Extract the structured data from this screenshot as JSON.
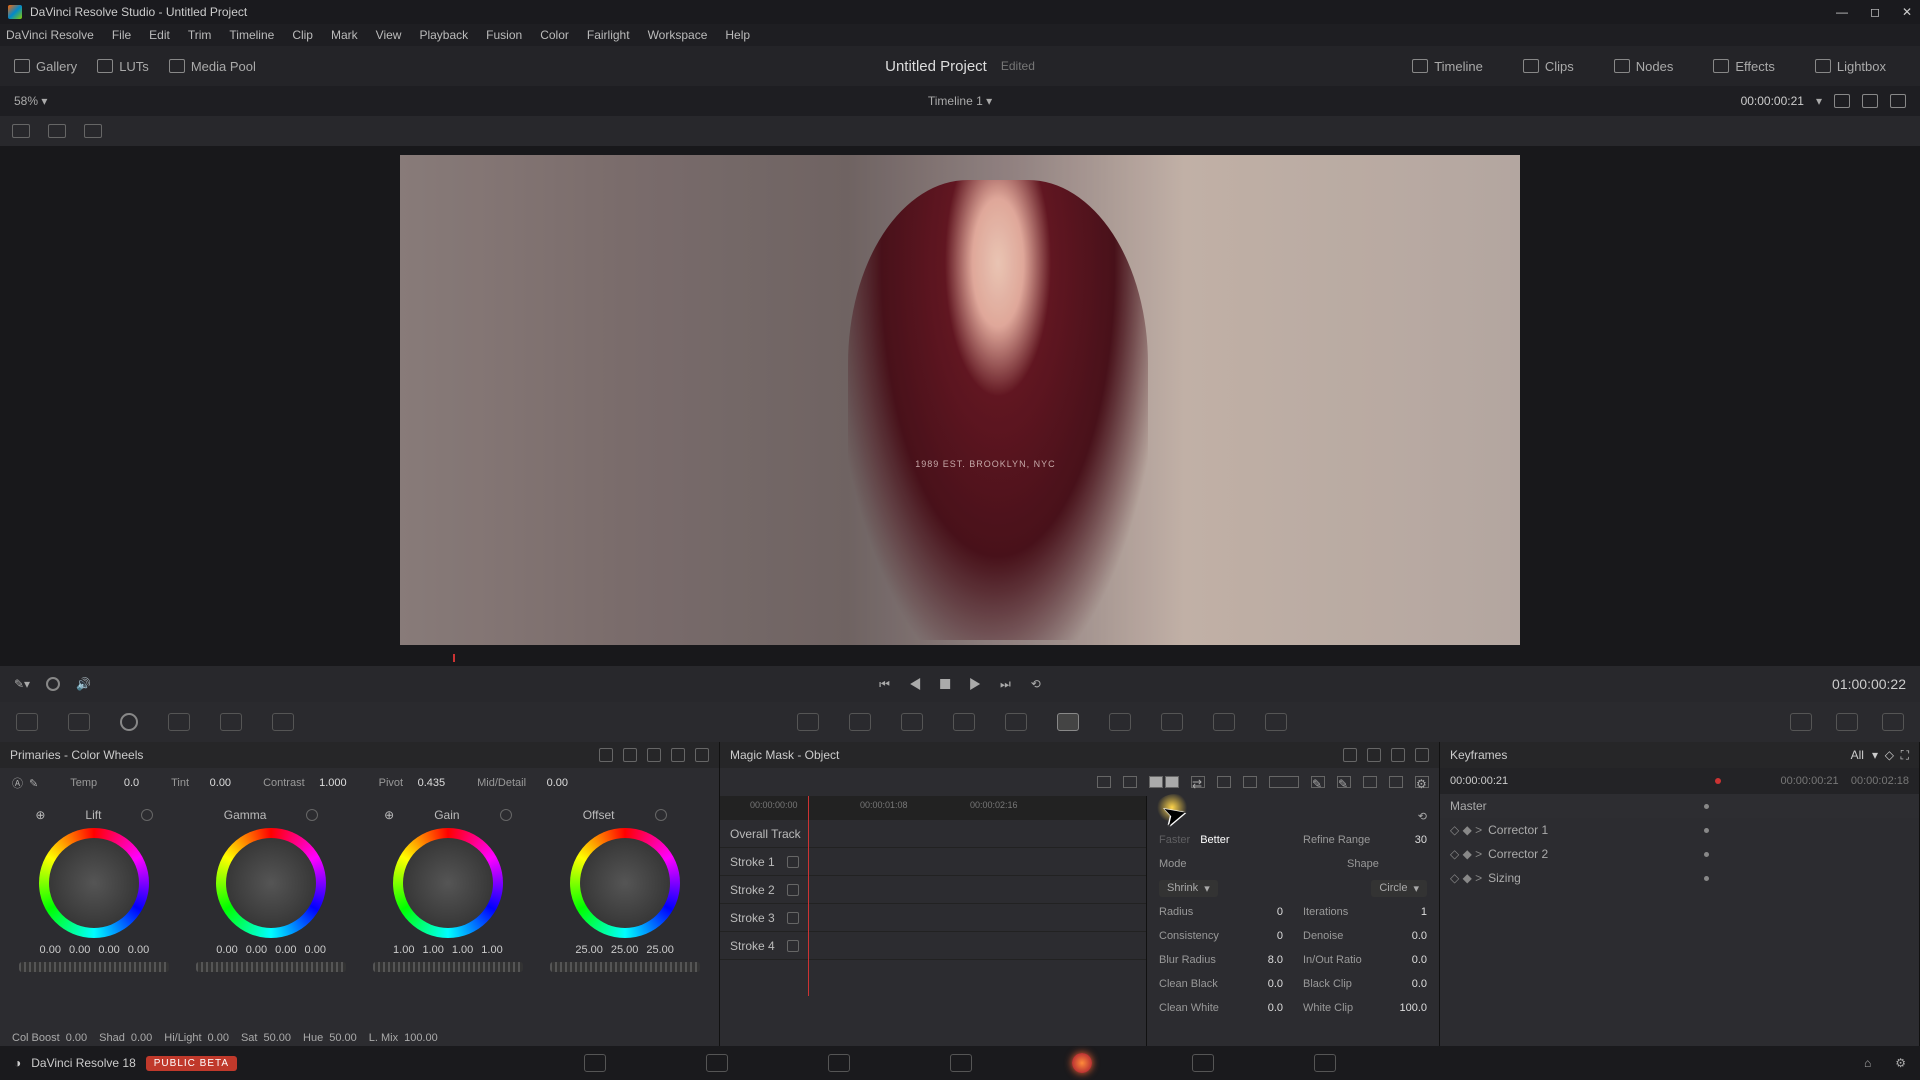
{
  "titlebar": {
    "text": "DaVinci Resolve Studio - Untitled Project"
  },
  "menubar": [
    "DaVinci Resolve",
    "File",
    "Edit",
    "Trim",
    "Timeline",
    "Clip",
    "Mark",
    "View",
    "Playback",
    "Fusion",
    "Color",
    "Fairlight",
    "Workspace",
    "Help"
  ],
  "toptoolbar": {
    "left": [
      "Gallery",
      "LUTs",
      "Media Pool"
    ],
    "project": "Untitled Project",
    "edited": "Edited",
    "right": [
      "Timeline",
      "Clips",
      "Nodes",
      "Effects",
      "Lightbox"
    ]
  },
  "subheader": {
    "zoom": "58%",
    "timeline": "Timeline 1",
    "timecode": "00:00:00:21"
  },
  "transport": {
    "tc": "01:00:00:22"
  },
  "primaries": {
    "title": "Primaries - Color Wheels",
    "adjust": {
      "temp_lbl": "Temp",
      "temp": "0.0",
      "tint_lbl": "Tint",
      "tint": "0.00",
      "contrast_lbl": "Contrast",
      "contrast": "1.000",
      "pivot_lbl": "Pivot",
      "pivot": "0.435",
      "md_lbl": "Mid/Detail",
      "md": "0.00"
    },
    "wheels": {
      "lift": {
        "title": "Lift",
        "vals": [
          "0.00",
          "0.00",
          "0.00",
          "0.00"
        ]
      },
      "gamma": {
        "title": "Gamma",
        "vals": [
          "0.00",
          "0.00",
          "0.00",
          "0.00"
        ]
      },
      "gain": {
        "title": "Gain",
        "vals": [
          "1.00",
          "1.00",
          "1.00",
          "1.00"
        ]
      },
      "offset": {
        "title": "Offset",
        "vals": [
          "25.00",
          "25.00",
          "25.00"
        ]
      }
    },
    "bottom": {
      "cb_lbl": "Col Boost",
      "cb": "0.00",
      "shad_lbl": "Shad",
      "shad": "0.00",
      "hl_lbl": "Hi/Light",
      "hl": "0.00",
      "sat_lbl": "Sat",
      "sat": "50.00",
      "hue_lbl": "Hue",
      "hue": "50.00",
      "lm_lbl": "L. Mix",
      "lm": "100.00"
    }
  },
  "mask": {
    "title": "Magic Mask - Object",
    "timeticks": [
      "00:00:00:00",
      "00:00:01:08",
      "00:00:02:16"
    ],
    "tracks": [
      "Overall Track",
      "Stroke 1",
      "Stroke 2",
      "Stroke 3",
      "Stroke 4"
    ],
    "quality": {
      "faster": "Faster",
      "better": "Better"
    },
    "props": {
      "refine_lbl": "Refine Range",
      "refine": "30",
      "mode_lbl": "Mode",
      "shape_lbl": "Shape",
      "mode": "Shrink",
      "shape": "Circle",
      "radius_lbl": "Radius",
      "radius": "0",
      "iter_lbl": "Iterations",
      "iter": "1",
      "cons_lbl": "Consistency",
      "cons": "0",
      "den_lbl": "Denoise",
      "den": "0.0",
      "blur_lbl": "Blur Radius",
      "blur": "8.0",
      "io_lbl": "In/Out Ratio",
      "io": "0.0",
      "cb_lbl": "Clean Black",
      "cb": "0.0",
      "bc_lbl": "Black Clip",
      "bc": "0.0",
      "cw_lbl": "Clean White",
      "cw": "0.0",
      "wc_lbl": "White Clip",
      "wc": "100.0"
    }
  },
  "keyframes": {
    "title": "Keyframes",
    "all": "All",
    "tc": "00:00:00:21",
    "ruler": [
      "00:00:00:21",
      "00:00:02:18"
    ],
    "rows": [
      "Master",
      "Corrector 1",
      "Corrector 2",
      "Sizing"
    ]
  },
  "pagebar": {
    "ver": "DaVinci Resolve 18",
    "badge": "PUBLIC BETA"
  }
}
